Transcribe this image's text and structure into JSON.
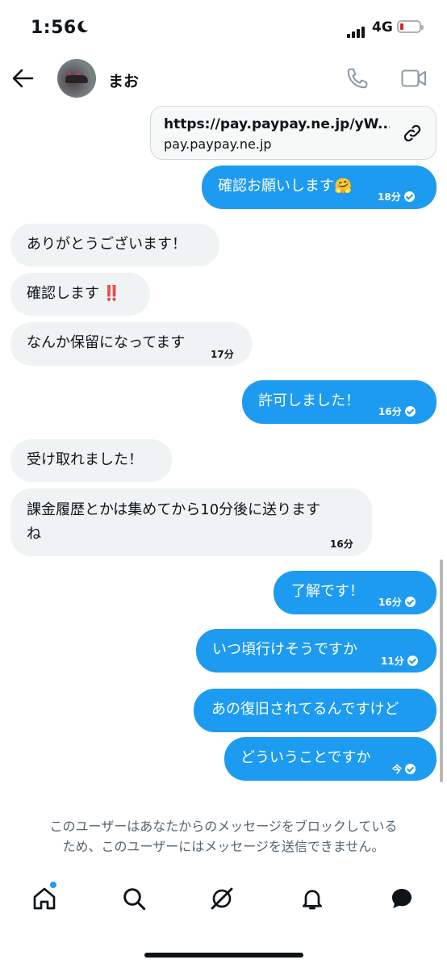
{
  "status_bar": {
    "time": "1:56",
    "network": "4G"
  },
  "header": {
    "contact_name": "まお"
  },
  "link_card": {
    "url": "https://pay.paypay.ne.jp/yW...",
    "domain": "pay.paypay.ne.jp"
  },
  "messages": [
    {
      "direction": "out",
      "text": "確認お願いします",
      "emoji": "🤗",
      "time": "18分",
      "sent_check": true
    },
    {
      "direction": "in",
      "text": "ありがとうございます！"
    },
    {
      "direction": "in",
      "text": "確認します",
      "emoji": "‼️"
    },
    {
      "direction": "in",
      "text": "なんか保留になってます",
      "time": "17分"
    },
    {
      "direction": "out",
      "text": "許可しました！",
      "time": "16分",
      "sent_check": true
    },
    {
      "direction": "in",
      "text": "受け取れました！"
    },
    {
      "direction": "in",
      "text_line1": "課金履歴とかは集めてから10分後に送ります",
      "text_line2": "ね",
      "time": "16分"
    },
    {
      "direction": "out",
      "text": "了解です！",
      "time": "16分",
      "sent_check": true
    },
    {
      "direction": "out",
      "text": "いつ頃行けそうですか",
      "time": "11分",
      "sent_check": true
    },
    {
      "direction": "out",
      "text": "あの復旧されてるんですけど"
    },
    {
      "direction": "out",
      "text": "どういうことですか",
      "time": "今",
      "sent_check": true
    }
  ],
  "footer_notice": {
    "line1": "このユーザーはあなたからのメッセージをブロックしている",
    "line2": "ため、このユーザーにはメッセージを送信できません。"
  },
  "colors": {
    "accent": "#1d9bf0",
    "incoming_bubble": "#eff3f4",
    "muted_text": "#536471"
  },
  "tab_bar": {
    "icons": [
      "home-icon",
      "search-icon",
      "grok-icon",
      "notifications-icon",
      "messages-icon"
    ],
    "home_has_badge": true
  }
}
